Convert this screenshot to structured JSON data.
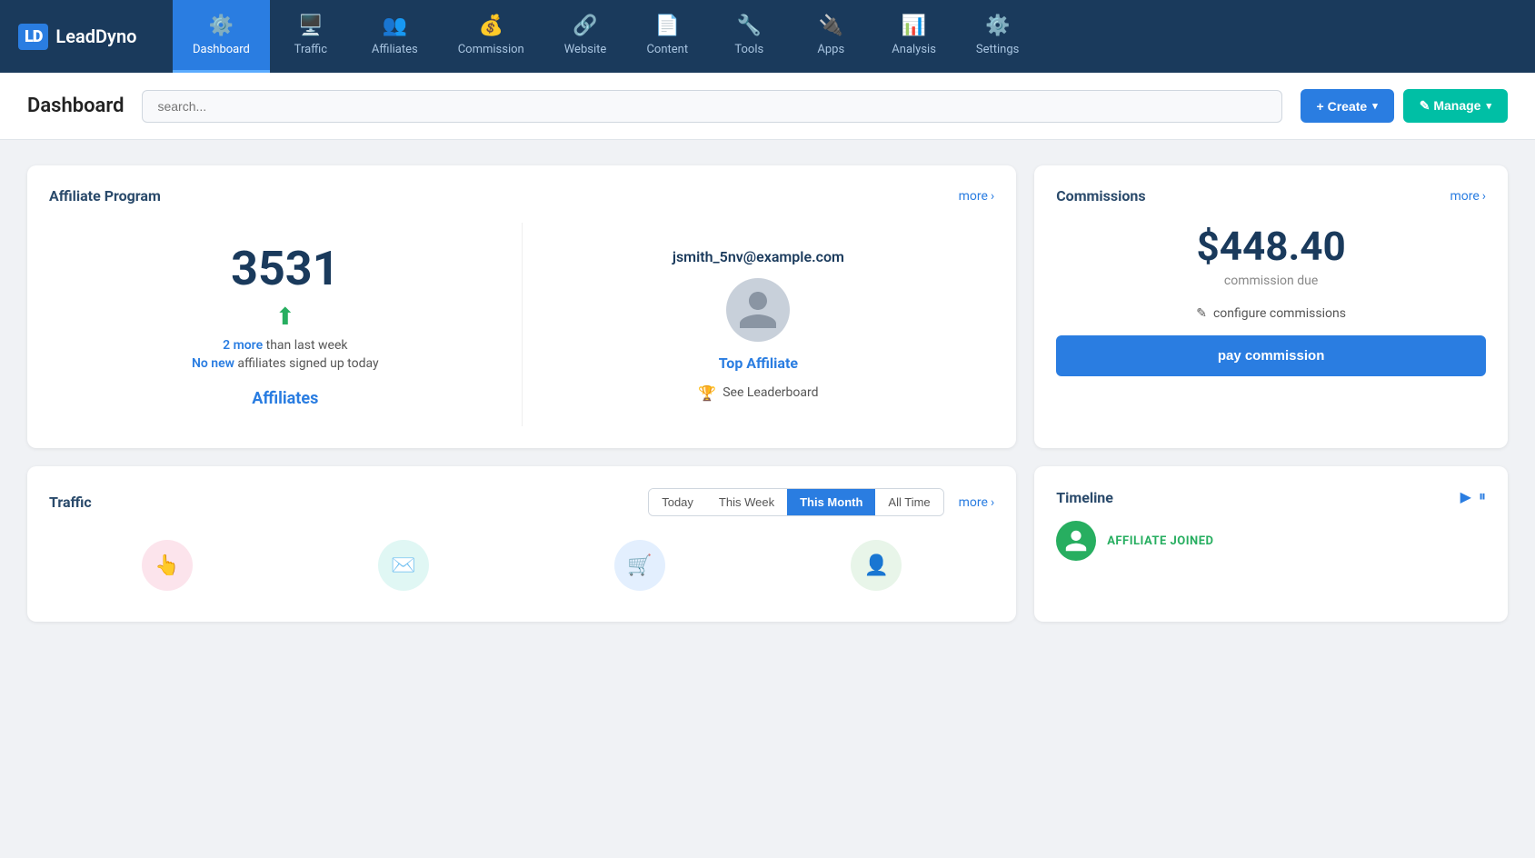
{
  "brand": {
    "icon": "LD",
    "name": "LeadDyno"
  },
  "nav": {
    "items": [
      {
        "id": "dashboard",
        "label": "Dashboard",
        "icon": "⚙",
        "active": true
      },
      {
        "id": "traffic",
        "label": "Traffic",
        "icon": "🖥",
        "active": false
      },
      {
        "id": "affiliates",
        "label": "Affiliates",
        "icon": "👥",
        "active": false
      },
      {
        "id": "commission",
        "label": "Commission",
        "icon": "💰",
        "active": false
      },
      {
        "id": "website",
        "label": "Website",
        "icon": "🔗",
        "active": false
      },
      {
        "id": "content",
        "label": "Content",
        "icon": "📄",
        "active": false
      },
      {
        "id": "tools",
        "label": "Tools",
        "icon": "🔧",
        "active": false
      },
      {
        "id": "apps",
        "label": "Apps",
        "icon": "🔌",
        "active": false
      },
      {
        "id": "analysis",
        "label": "Analysis",
        "icon": "📊",
        "active": false
      },
      {
        "id": "settings",
        "label": "Settings",
        "icon": "⚙",
        "active": false
      }
    ]
  },
  "header": {
    "title": "Dashboard",
    "search_placeholder": "search...",
    "create_label": "+ Create",
    "manage_label": "✎ Manage"
  },
  "affiliate_program": {
    "title": "Affiliate Program",
    "more_label": "more",
    "count": "3531",
    "more_than_last_week_prefix": "2 more",
    "more_than_last_week_suffix": "than last week",
    "no_new_prefix": "No new",
    "no_new_suffix": "affiliates signed up today",
    "affiliates_link": "Affiliates",
    "top_affiliate_email": "jsmith_5nv@example.com",
    "top_affiliate_label": "Top Affiliate",
    "see_leaderboard": "See Leaderboard"
  },
  "commissions": {
    "title": "Commissions",
    "more_label": "more",
    "amount": "$448.40",
    "due_label": "commission due",
    "configure_label": "configure commissions",
    "pay_label": "pay commission"
  },
  "traffic": {
    "title": "Traffic",
    "more_label": "more",
    "tabs": [
      {
        "label": "Today",
        "active": false
      },
      {
        "label": "This Week",
        "active": false
      },
      {
        "label": "This Month",
        "active": true
      },
      {
        "label": "All Time",
        "active": false
      }
    ]
  },
  "timeline": {
    "title": "Timeline",
    "event_label": "AFFILIATE JOINED"
  }
}
